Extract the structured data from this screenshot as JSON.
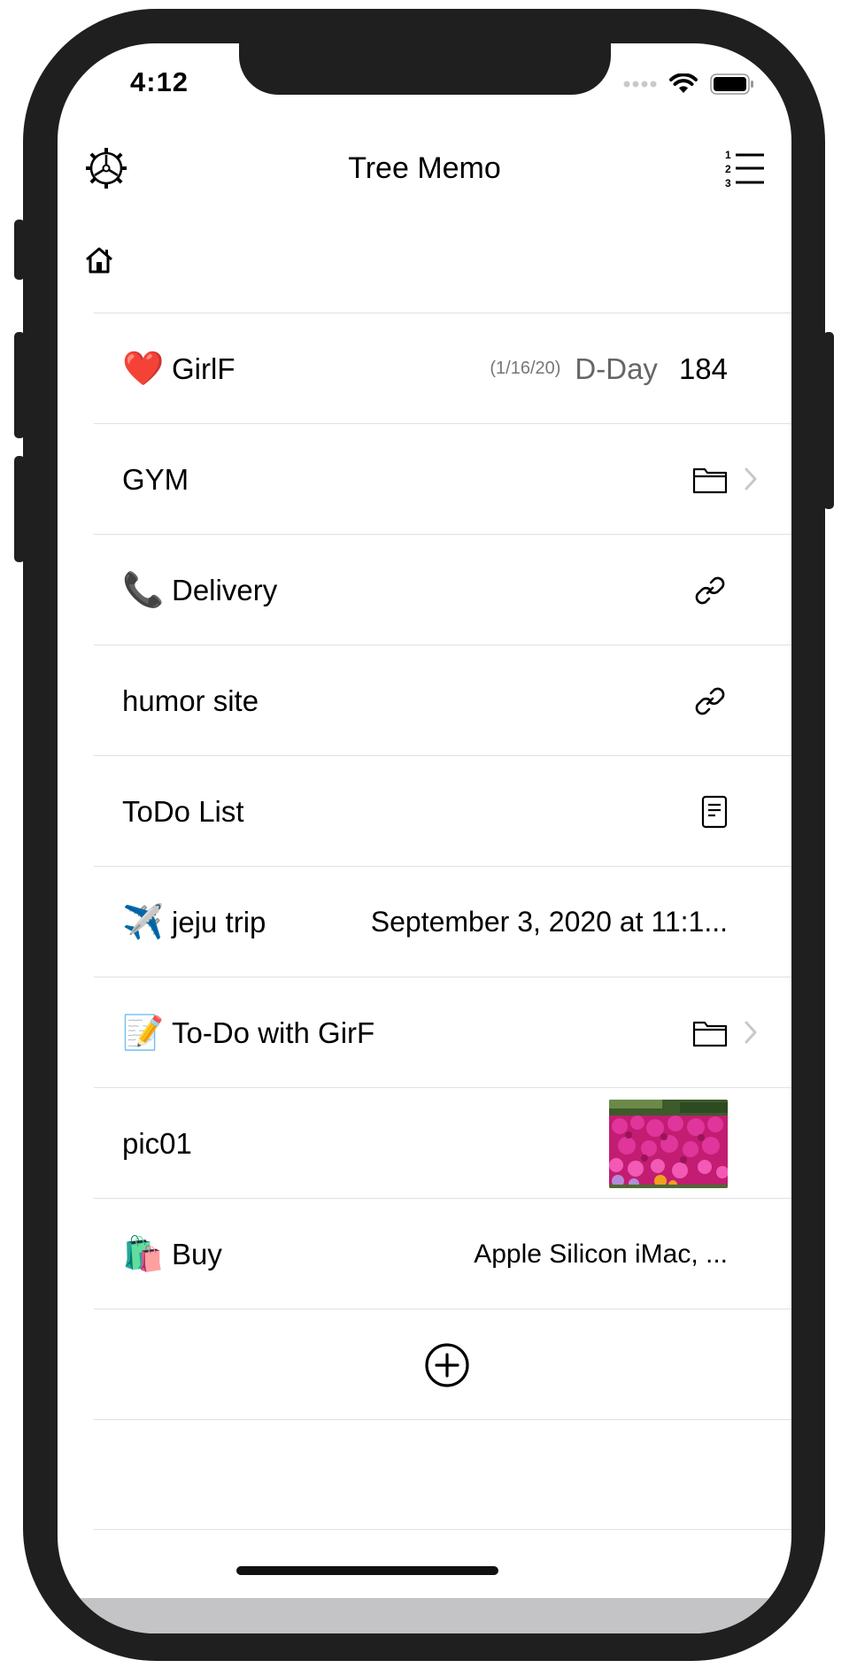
{
  "status_bar": {
    "time": "4:12",
    "signal_icon": "cellular-dots-icon",
    "wifi_icon": "wifi-icon",
    "battery_icon": "battery-icon"
  },
  "nav": {
    "title": "Tree Memo",
    "left_icon": "settings-gear-icon",
    "right_icon": "numbered-list-icon"
  },
  "breadcrumb": {
    "home_icon": "home-icon"
  },
  "items": [
    {
      "emoji": "❤️",
      "title": "GirlF",
      "type": "dday",
      "date": "(1/16/20)",
      "label": "D-Day",
      "count": "184"
    },
    {
      "emoji": "",
      "title": "GYM",
      "type": "folder",
      "icon": "folder-icon"
    },
    {
      "emoji": "📞",
      "title": "Delivery",
      "type": "link",
      "icon": "link-icon"
    },
    {
      "emoji": "",
      "title": "humor site",
      "type": "link",
      "icon": "link-icon"
    },
    {
      "emoji": "",
      "title": "ToDo List",
      "type": "note",
      "icon": "document-icon"
    },
    {
      "emoji": "✈️",
      "title": "jeju trip",
      "type": "datetime",
      "detail": "September 3, 2020 at 11:1..."
    },
    {
      "emoji": "📝",
      "title": "To-Do with GirF",
      "type": "folder",
      "icon": "folder-icon"
    },
    {
      "emoji": "",
      "title": "pic01",
      "type": "photo",
      "image": "flower-thumbnail"
    },
    {
      "emoji": "🛍️",
      "title": "Buy",
      "type": "text",
      "detail": "Apple Silicon iMac, ..."
    }
  ],
  "add_button_icon": "plus-circle-icon",
  "colors": {
    "frame": "#1f1f20",
    "separator": "#e0e0e0",
    "chevron": "#c7c7cc",
    "secondary_text": "#777777"
  }
}
